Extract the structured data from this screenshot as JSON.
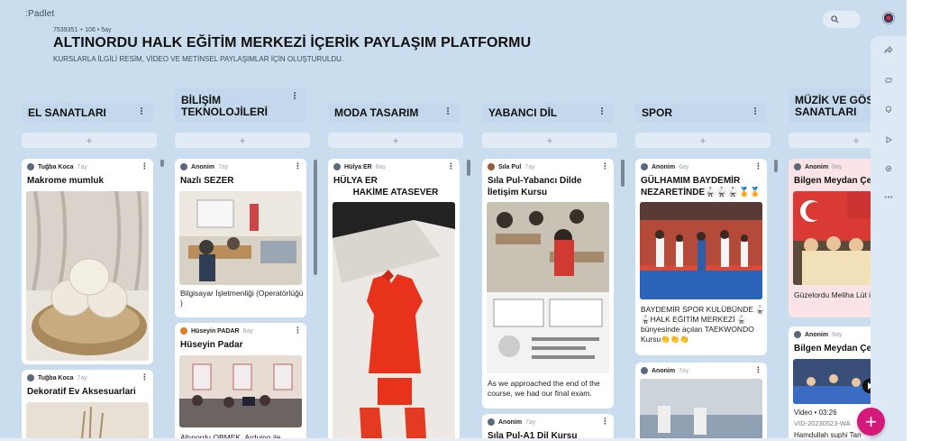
{
  "app": {
    "logo": ":Padlet",
    "meta": "7539351 + 106 • 5ay",
    "title": "ALTINORDU HALK EĞİTİM MERKEZİ İÇERİK PAYLAŞIM PLATFORMU",
    "subtitle": "KURSLARLA İLGİLİ RESİM, VİDEO VE METİNSEL PAYLAŞIMLAR İÇİN OLUŞTURULDU."
  },
  "icons": {
    "search": "search-icon",
    "kebab": "⋮",
    "more": "⋯",
    "add": "+"
  },
  "colors": {
    "background": "#c9ddef",
    "column_header": "#c3d8ec",
    "fab": "#d4197a",
    "card_pink": "#fbe3e6"
  },
  "columns": [
    {
      "name": "EL SANATLARI",
      "cards": [
        {
          "author": "Tuğba Koca",
          "time": "7ay",
          "title": "Makrome mumluk",
          "body": ""
        },
        {
          "author": "Tuğba Koca",
          "time": "7ay",
          "title": "Dekoratif Ev Aksesuarlari",
          "body": ""
        }
      ]
    },
    {
      "name": "BİLİŞİM TEKNOLOJİLERİ",
      "cards": [
        {
          "author": "Anonim",
          "time": "7ay",
          "title": "Nazlı SEZER",
          "body": "Bilgisayar İşletmenliği (Operatörlüğü )"
        },
        {
          "author": "Hüseyin PADAR",
          "time": "8ay",
          "title": "Hüseyin Padar",
          "body": "Altınordu OBMEK, Arduino ile"
        }
      ]
    },
    {
      "name": "MODA TASARIM",
      "cards": [
        {
          "author": "Hülya ER",
          "time": "8ay",
          "title_line1": "HÜLYA ER",
          "title_line2": "HAKİME ATASEVER",
          "body": ""
        }
      ]
    },
    {
      "name": "YABANCI DİL",
      "cards": [
        {
          "author": "Sıla Pul",
          "time": "7ay",
          "title": "Sıla Pul-Yabancı Dilde İletişim Kursu",
          "body": "As we approached the end of the course, we had our final exam."
        },
        {
          "author": "Anonim",
          "time": "7ay",
          "title": "Sıla Pul-A1 Dil Kursu",
          "body": ""
        }
      ]
    },
    {
      "name": "SPOR",
      "cards": [
        {
          "author": "Anonim",
          "time": "6ay",
          "title": "GÜLHAMIM BAYDEMİR NEZARETİNDE🥋🥋🥋🏅🏅",
          "body": "BAYDEMİR SPOR KULÜBÜNDE 🥋 🥋HALK EĞİTİM MERKEZİ 🥋 bünyesinde açılan TAEKWONDO Kursu👏👏👏"
        },
        {
          "author": "Anonim",
          "time": "7ay",
          "title": "",
          "body": ""
        }
      ]
    },
    {
      "name": "MÜZİK VE GÖS SANATLARI",
      "cards": [
        {
          "author": "Anonim",
          "time": "8ay",
          "title": "Bilgen Meydan Çe",
          "body": "Güzelordu Meliha Lüt ilk okulu"
        },
        {
          "author": "Anonim",
          "time": "8ay",
          "title": "Bilgen Meydan Çe",
          "video_label": "Video • 03:26",
          "file": "VID-20230523-WA",
          "body": "Hamdullah suphi Tan"
        }
      ]
    }
  ]
}
